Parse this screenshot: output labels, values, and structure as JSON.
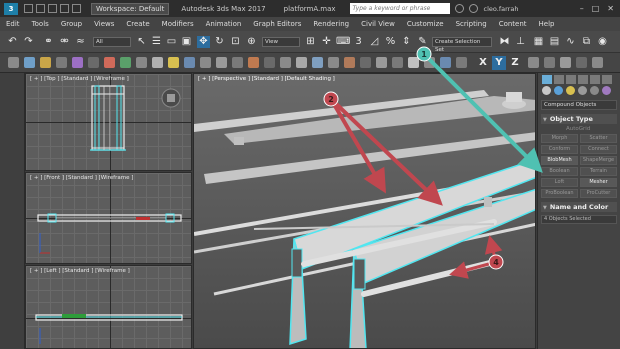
{
  "titlebar": {
    "logo": "3",
    "workspace": "Workspace: Default",
    "app_title": "Autodesk 3ds Max 2017",
    "file_title": "platformA.max",
    "search_placeholder": "Type a keyword or phrase",
    "user": "cleo.farrah"
  },
  "menu": [
    "Edit",
    "Tools",
    "Group",
    "Views",
    "Create",
    "Modifiers",
    "Animation",
    "Graph Editors",
    "Rendering",
    "Civil View",
    "Customize",
    "Scripting",
    "Content",
    "Help"
  ],
  "toolbar": {
    "filter": "All",
    "ref_coord": "View",
    "selection_set": "Create Selection Set"
  },
  "ribbon": {
    "axis_x": "X",
    "axis_y": "Y",
    "axis_z": "Z"
  },
  "viewports": {
    "top": "[ + ] [Top ] [Standard ] [Wireframe ]",
    "front": "[ + ] [Front ] [Standard ] [Wireframe ]",
    "left": "[ + ] [Left ] [Standard ] [Wireframe ]",
    "perspective": "[ + ] [Perspective ] [Standard ] [Default Shading ]"
  },
  "command_panel": {
    "category": "Compound Objects",
    "object_type_header": "Object Type",
    "autogrid": "AutoGrid",
    "buttons": [
      "Morph",
      "Scatter",
      "Conform",
      "Connect",
      "BlobMesh",
      "ShapeMerge",
      "Boolean",
      "Terrain",
      "Loft",
      "Mesher",
      "ProBoolean",
      "ProCutter"
    ],
    "name_color_header": "Name and Color",
    "selection_text": "4 Objects Selected"
  },
  "callouts": {
    "c1": "1",
    "c2": "2",
    "c4": "4"
  },
  "colors": {
    "callout_red": "#c0474f",
    "callout_teal": "#4fc1b2",
    "selection_cyan": "#52e6f0",
    "highlight_blue": "#2d6d9e"
  }
}
